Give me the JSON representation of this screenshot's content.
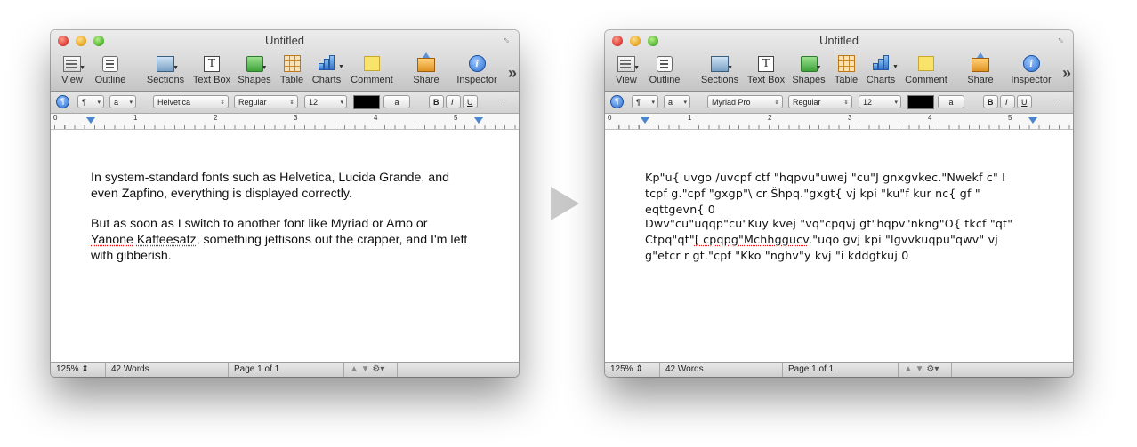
{
  "arrow": "right-pointing-triangle",
  "window_left": {
    "title": "Untitled",
    "toolbar": {
      "view": "View",
      "outline": "Outline",
      "sections": "Sections",
      "textbox": "Text Box",
      "shapes": "Shapes",
      "table": "Table",
      "charts": "Charts",
      "comment": "Comment",
      "share": "Share",
      "inspector": "Inspector",
      "overflow": "»"
    },
    "format": {
      "paragraph_style": "¶",
      "char_style": "a",
      "font": "Helvetica",
      "typeface": "Regular",
      "size": "12",
      "color": "#000000",
      "highlight": "a",
      "bold": "B",
      "italic": "I",
      "underline": "U",
      "more": "..."
    },
    "ruler": {
      "n0": "0",
      "n1": "1",
      "n2": "2",
      "n3": "3",
      "n4": "4",
      "n5": "5"
    },
    "body": {
      "p1": "In system-standard fonts such as Helvetica, Lucida Grande, and even Zapfino, everything is displayed correctly.",
      "p2_a": "But as soon as I switch to another font like Myriad or Arno or",
      "p2_spell1": "Yanone",
      "p2_space": " ",
      "p2_spell2": "Kaffeesatz",
      "p2_b": ", something jettisons out the crapper, and I'm left with gibberish."
    },
    "status": {
      "zoom": "125%",
      "words": "42 Words",
      "page": "Page 1 of 1"
    }
  },
  "window_right": {
    "title": "Untitled",
    "toolbar": {
      "view": "View",
      "outline": "Outline",
      "sections": "Sections",
      "textbox": "Text Box",
      "shapes": "Shapes",
      "table": "Table",
      "charts": "Charts",
      "comment": "Comment",
      "share": "Share",
      "inspector": "Inspector",
      "overflow": "»"
    },
    "format": {
      "paragraph_style": "¶",
      "char_style": "a",
      "font": "Myriad Pro",
      "typeface": "Regular",
      "size": "12",
      "color": "#000000",
      "highlight": "a",
      "bold": "B",
      "italic": "I",
      "underline": "U",
      "more": "..."
    },
    "ruler": {
      "n0": "0",
      "n1": "1",
      "n2": "2",
      "n3": "3",
      "n4": "4",
      "n5": "5"
    },
    "body": {
      "p1": "Kp\"u{ uvgo /uvcpf ctf \"hqpvu\"uwej \"cu\"J gnxgvkec.\"Nwekf c\" I tcpf g.\"cpf \"gxgp\"\\ cr Šhpq.\"gxgt{ vj kpi \"ku\"f kur nc{ gf \" eqttgevn{ 0",
      "p2_a": "Dwv\"cu\"uqqp\"cu\"Kuy kvej \"vq\"cpqvj gt\"hqpv\"nkng\"O{ tkcf \"qt\" Ctpq\"qt\"",
      "p2_spell1": "[ cpqpg\"Mchhggucv",
      "p2_space": "",
      "p2_spell2": "",
      "p2_b": ".\"uqo gvj kpi \"lgvvkuqpu\"qwv\" vj g\"etcr r gt.\"cpf \"Kko \"nghv\"y kvj \"i kddgtkuj 0"
    },
    "status": {
      "zoom": "125%",
      "words": "42 Words",
      "page": "Page 1 of 1"
    }
  }
}
